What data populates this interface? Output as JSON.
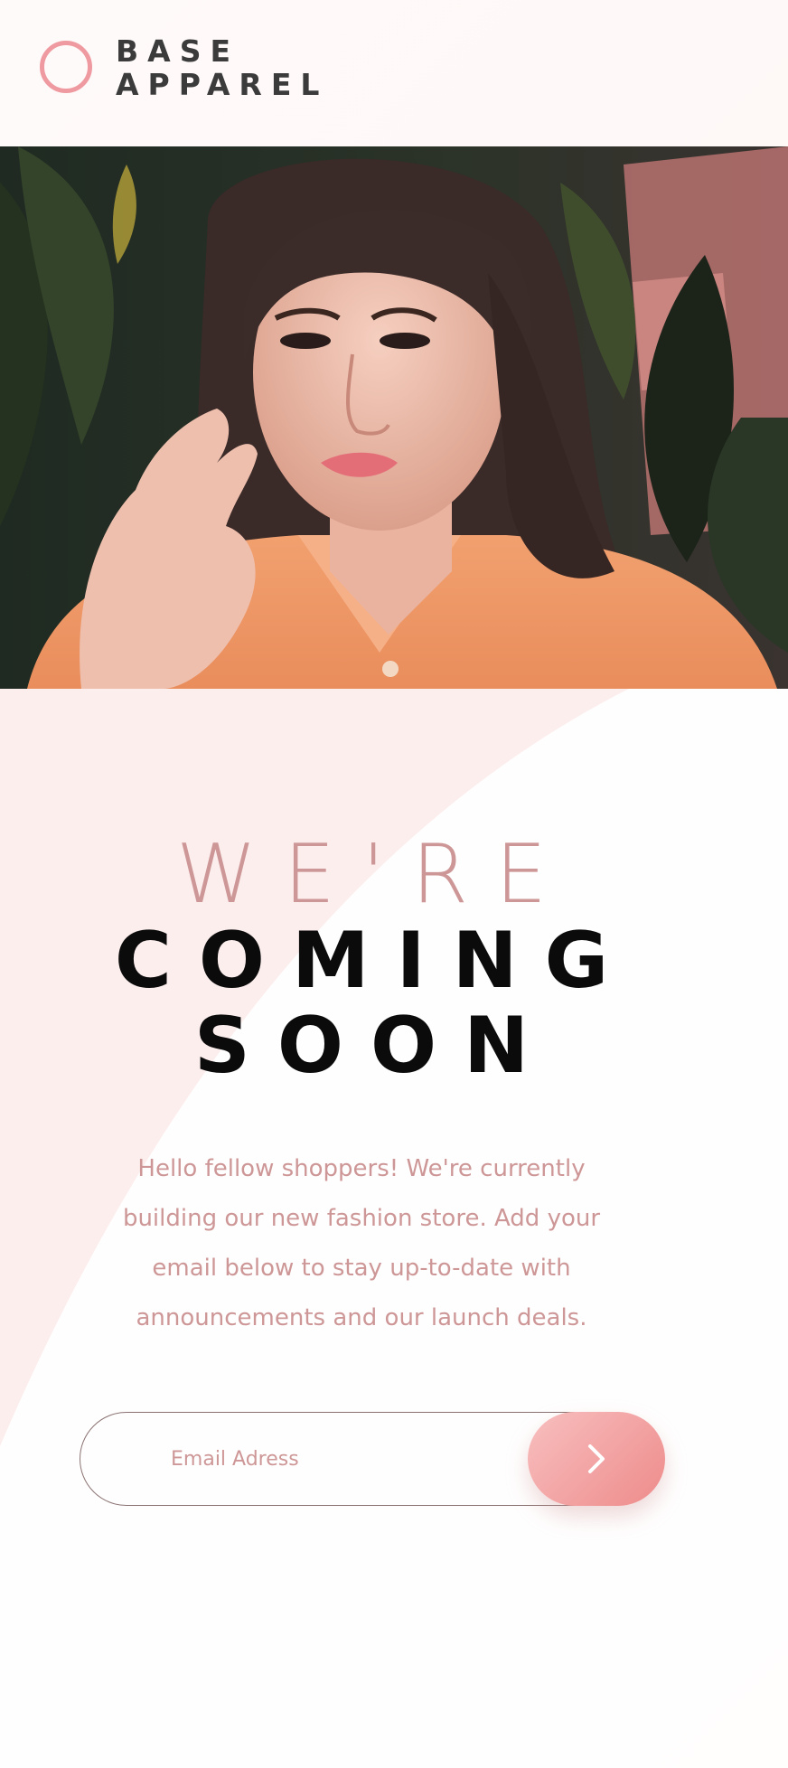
{
  "brand": {
    "line1": "BASE",
    "line2": "APPAREL",
    "logo_color": "#ee9aa0",
    "text_color": "#3b3b3b"
  },
  "hero": {
    "icon": "fashion-model-photo"
  },
  "headline": {
    "light": "WE'RE",
    "dark_line1": "COMING",
    "dark_line2": "SOON",
    "accent_color": "#ce9797"
  },
  "intro": {
    "text": "Hello fellow shoppers! We're currently building our new fashion store. Add your email below to stay up-to-date with announcements and our launch deals."
  },
  "form": {
    "email_placeholder": "Email Adress",
    "submit_icon": "chevron-right-icon",
    "button_gradient": [
      "#f8bfbf",
      "#ee8b8b"
    ]
  }
}
